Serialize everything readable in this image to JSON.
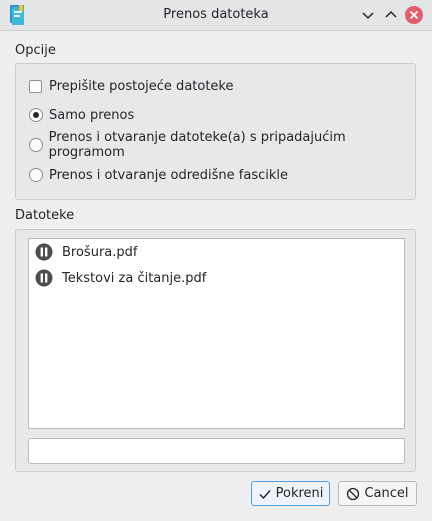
{
  "window": {
    "title": "Prenos datoteka",
    "app_icon": "file-transfer-icon",
    "controls": [
      "minimize-icon",
      "maximize-icon",
      "close-icon"
    ]
  },
  "options": {
    "label": "Opcije",
    "overwrite_checkbox": {
      "label": "Prepišite postojeće datoteke",
      "checked": false
    },
    "modes": [
      {
        "label": "Samo prenos",
        "selected": true
      },
      {
        "label": "Prenos i otvaranje datoteke(a) s pripadajućim programom",
        "selected": false
      },
      {
        "label": "Prenos i otvaranje odredišne fascikle",
        "selected": false
      }
    ]
  },
  "files": {
    "label": "Datoteke",
    "items": [
      {
        "name": "Brošura.pdf",
        "status_icon": "pause-icon"
      },
      {
        "name": "Tekstovi za čitanje.pdf",
        "status_icon": "pause-icon"
      }
    ],
    "path_field": {
      "value": ""
    }
  },
  "buttons": {
    "start": {
      "label": "Pokreni",
      "icon": "checkmark-icon"
    },
    "cancel": {
      "label": "Cancel",
      "icon": "cancel-icon"
    }
  },
  "colors": {
    "accent": "#3daee9",
    "close_button": "#e55d6d",
    "titlebar": "#e3e5e7"
  }
}
